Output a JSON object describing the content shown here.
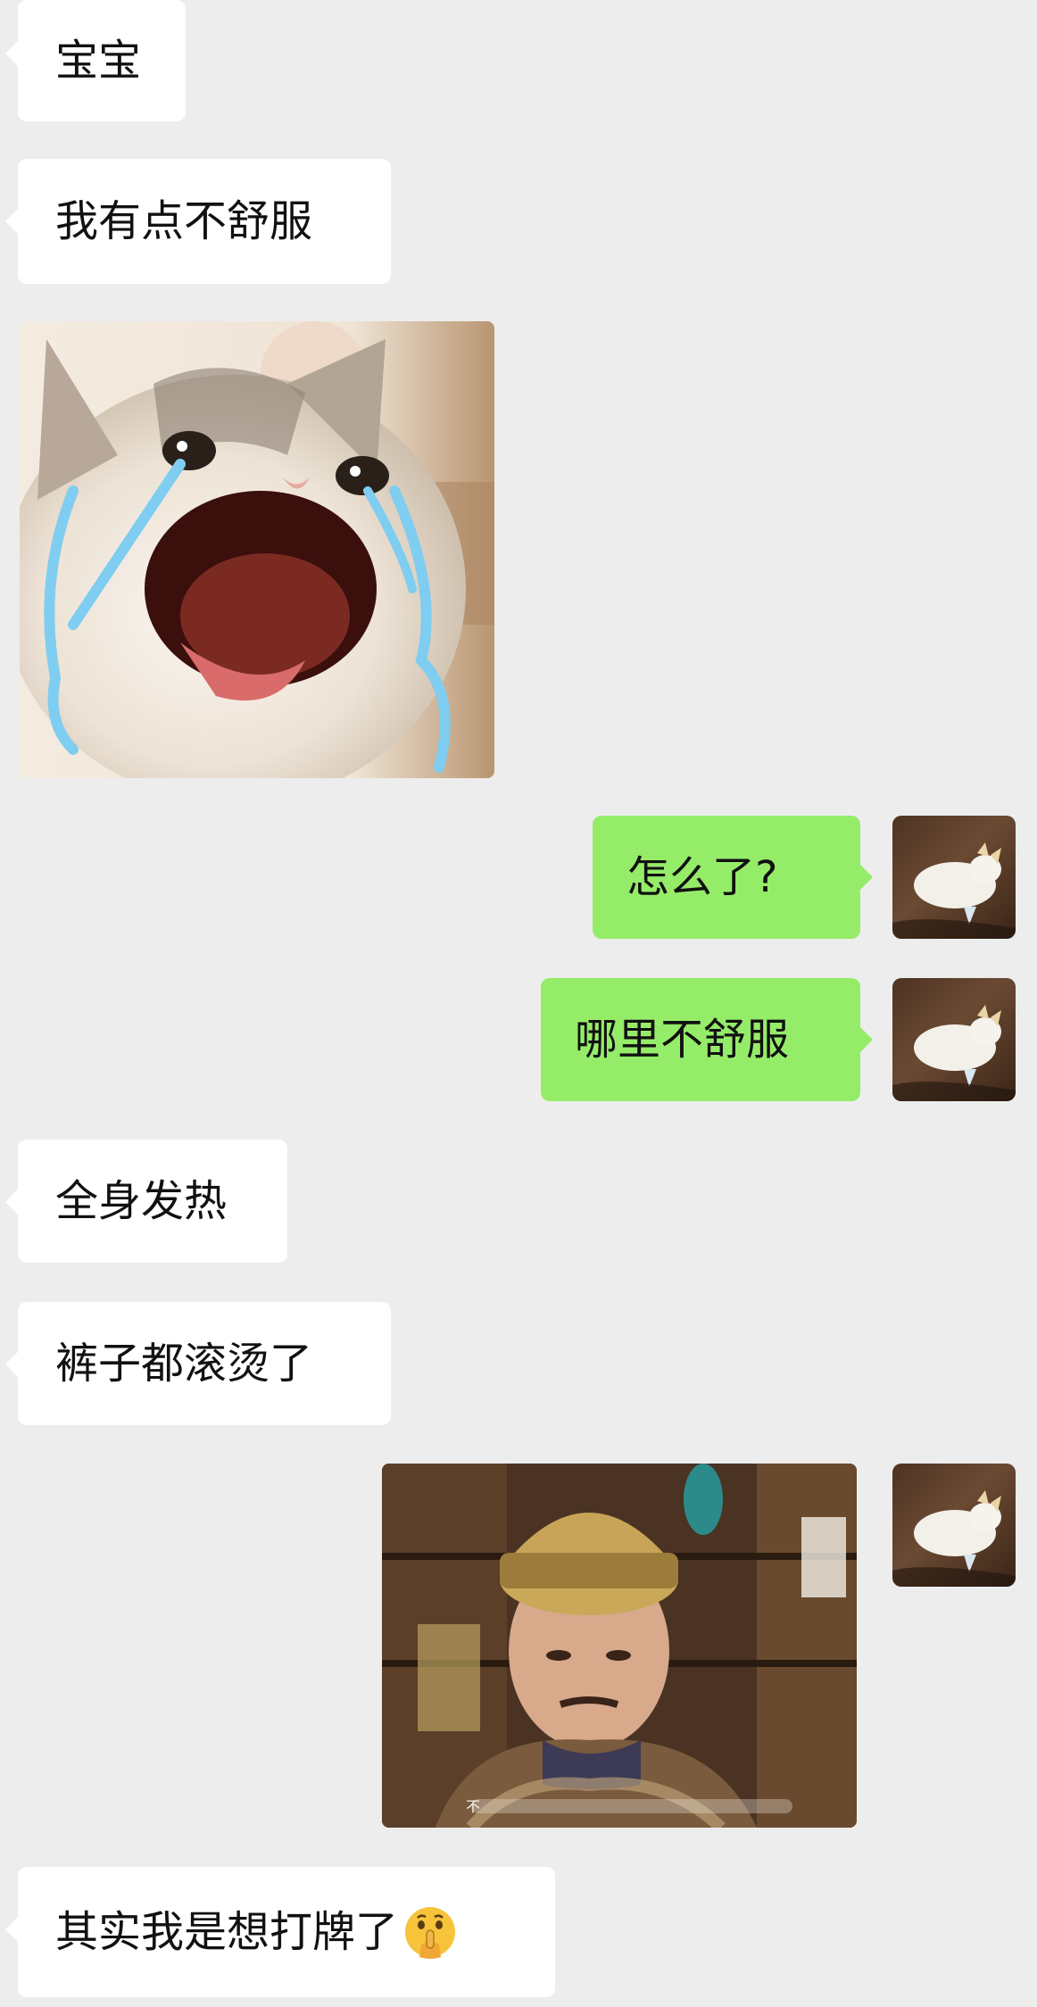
{
  "messages": [
    {
      "side": "left",
      "type": "text",
      "text": "宝宝"
    },
    {
      "side": "left",
      "type": "text",
      "text": "我有点不舒服"
    },
    {
      "side": "left",
      "type": "sticker",
      "sticker": "crying-cat-meme"
    },
    {
      "side": "right",
      "type": "text",
      "text": "怎么了?"
    },
    {
      "side": "right",
      "type": "text",
      "text": "哪里不舒服"
    },
    {
      "side": "left",
      "type": "text",
      "text": "全身发热"
    },
    {
      "side": "left",
      "type": "text",
      "text": "裤子都滚烫了"
    },
    {
      "side": "right",
      "type": "sticker",
      "sticker": "qing-dynasty-official-meme",
      "caption": "不"
    },
    {
      "side": "left",
      "type": "text",
      "text": "其实我是想打牌了",
      "trailing_emoji": "shushing-face"
    }
  ],
  "self_avatar": "lying-white-cat-avatar",
  "colors": {
    "background": "#ededed",
    "incoming_bubble": "#ffffff",
    "outgoing_bubble": "#95ec69",
    "text": "#111111"
  }
}
